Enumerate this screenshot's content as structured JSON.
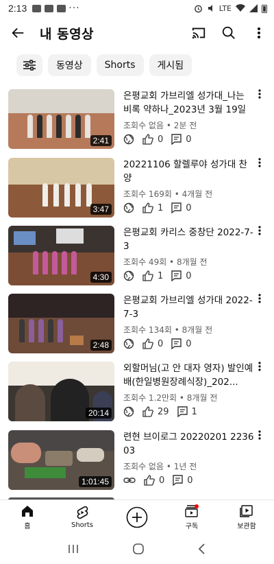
{
  "status_bar": {
    "time": "2:13",
    "overflow": "···",
    "battery_label": "LTE"
  },
  "app_bar": {
    "title": "내 동영상"
  },
  "chips": [
    "동영상",
    "Shorts",
    "게시됨"
  ],
  "videos": [
    {
      "title": "은평교회 가브리엘 성가대_나는 비록 약하나_2023년 3월 19일",
      "meta": "조회수 없음 • 2분 전",
      "duration": "2:41",
      "likes": "0",
      "comments": "0",
      "privacy": "public"
    },
    {
      "title": "20221106 할렐루야 성가대 찬양",
      "meta": "조회수 169회 • 4개월 전",
      "duration": "3:47",
      "likes": "1",
      "comments": "0",
      "privacy": "public"
    },
    {
      "title": "은평교회 카리스 중창단 2022-7-3",
      "meta": "조회수 49회 • 8개월 전",
      "duration": "4:30",
      "likes": "1",
      "comments": "0",
      "privacy": "public"
    },
    {
      "title": "은평교회 가브리엘 성가대 2022-7-3",
      "meta": "조회수 134회 • 8개월 전",
      "duration": "2:48",
      "likes": "0",
      "comments": "0",
      "privacy": "public"
    },
    {
      "title": "외할머님(고 안 대자 영자) 발인예배(한일병원장례식장)_202...",
      "meta": "조회수 1.2만회 • 8개월 전",
      "duration": "20:14",
      "likes": "29",
      "comments": "1",
      "privacy": "public"
    },
    {
      "title": "련현 브이로그 20220201 223603",
      "meta": "조회수 없음 • 1년 전",
      "duration": "1:01:45",
      "likes": "0",
      "comments": "0",
      "privacy": "unlisted"
    }
  ],
  "bottom_nav": [
    {
      "label": "홈",
      "icon": "home-icon"
    },
    {
      "label": "Shorts",
      "icon": "shorts-icon"
    },
    {
      "label": "",
      "icon": "create-icon"
    },
    {
      "label": "구독",
      "icon": "subscriptions-icon"
    },
    {
      "label": "보관함",
      "icon": "library-icon"
    }
  ],
  "colors": {
    "text": "#0f0f0f",
    "meta": "#606060",
    "chip_bg": "#f2f2f2",
    "badge": "#ff0000"
  }
}
